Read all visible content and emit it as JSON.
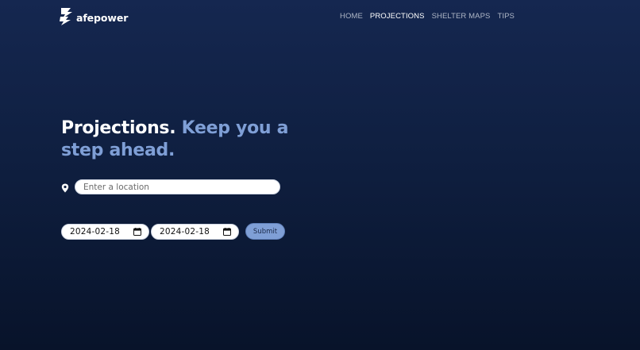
{
  "brand": {
    "name": "afepower",
    "logo_icon": "lightning-s-icon"
  },
  "nav": {
    "items": [
      {
        "label": "HOME",
        "active": false
      },
      {
        "label": "PROJECTIONS",
        "active": true
      },
      {
        "label": "SHELTER MAPS",
        "active": false
      },
      {
        "label": "TIPS",
        "active": false
      }
    ]
  },
  "hero": {
    "title_part1": "Projections.",
    "title_part2": "Keep you a step ahead."
  },
  "location": {
    "placeholder": "Enter a location",
    "value": "",
    "icon": "map-pin-icon"
  },
  "dates": {
    "start": "2024-02-18",
    "end": "2024-02-18",
    "icon": "calendar-icon"
  },
  "submit_label": "Submit",
  "colors": {
    "background_top": "#152750",
    "background_bottom": "#08132a",
    "accent": "#7f9fd6",
    "nav_text": "#aeb6c6"
  }
}
